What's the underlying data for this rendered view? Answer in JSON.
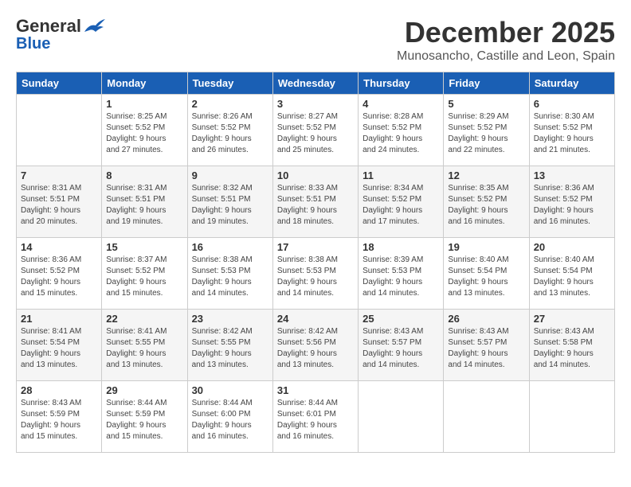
{
  "logo": {
    "general": "General",
    "blue": "Blue"
  },
  "header": {
    "month": "December 2025",
    "location": "Munosancho, Castille and Leon, Spain"
  },
  "weekdays": [
    "Sunday",
    "Monday",
    "Tuesday",
    "Wednesday",
    "Thursday",
    "Friday",
    "Saturday"
  ],
  "weeks": [
    [
      {
        "day": "",
        "info": ""
      },
      {
        "day": "1",
        "info": "Sunrise: 8:25 AM\nSunset: 5:52 PM\nDaylight: 9 hours\nand 27 minutes."
      },
      {
        "day": "2",
        "info": "Sunrise: 8:26 AM\nSunset: 5:52 PM\nDaylight: 9 hours\nand 26 minutes."
      },
      {
        "day": "3",
        "info": "Sunrise: 8:27 AM\nSunset: 5:52 PM\nDaylight: 9 hours\nand 25 minutes."
      },
      {
        "day": "4",
        "info": "Sunrise: 8:28 AM\nSunset: 5:52 PM\nDaylight: 9 hours\nand 24 minutes."
      },
      {
        "day": "5",
        "info": "Sunrise: 8:29 AM\nSunset: 5:52 PM\nDaylight: 9 hours\nand 22 minutes."
      },
      {
        "day": "6",
        "info": "Sunrise: 8:30 AM\nSunset: 5:52 PM\nDaylight: 9 hours\nand 21 minutes."
      }
    ],
    [
      {
        "day": "7",
        "info": "Sunrise: 8:31 AM\nSunset: 5:51 PM\nDaylight: 9 hours\nand 20 minutes."
      },
      {
        "day": "8",
        "info": "Sunrise: 8:31 AM\nSunset: 5:51 PM\nDaylight: 9 hours\nand 19 minutes."
      },
      {
        "day": "9",
        "info": "Sunrise: 8:32 AM\nSunset: 5:51 PM\nDaylight: 9 hours\nand 19 minutes."
      },
      {
        "day": "10",
        "info": "Sunrise: 8:33 AM\nSunset: 5:51 PM\nDaylight: 9 hours\nand 18 minutes."
      },
      {
        "day": "11",
        "info": "Sunrise: 8:34 AM\nSunset: 5:52 PM\nDaylight: 9 hours\nand 17 minutes."
      },
      {
        "day": "12",
        "info": "Sunrise: 8:35 AM\nSunset: 5:52 PM\nDaylight: 9 hours\nand 16 minutes."
      },
      {
        "day": "13",
        "info": "Sunrise: 8:36 AM\nSunset: 5:52 PM\nDaylight: 9 hours\nand 16 minutes."
      }
    ],
    [
      {
        "day": "14",
        "info": "Sunrise: 8:36 AM\nSunset: 5:52 PM\nDaylight: 9 hours\nand 15 minutes."
      },
      {
        "day": "15",
        "info": "Sunrise: 8:37 AM\nSunset: 5:52 PM\nDaylight: 9 hours\nand 15 minutes."
      },
      {
        "day": "16",
        "info": "Sunrise: 8:38 AM\nSunset: 5:53 PM\nDaylight: 9 hours\nand 14 minutes."
      },
      {
        "day": "17",
        "info": "Sunrise: 8:38 AM\nSunset: 5:53 PM\nDaylight: 9 hours\nand 14 minutes."
      },
      {
        "day": "18",
        "info": "Sunrise: 8:39 AM\nSunset: 5:53 PM\nDaylight: 9 hours\nand 14 minutes."
      },
      {
        "day": "19",
        "info": "Sunrise: 8:40 AM\nSunset: 5:54 PM\nDaylight: 9 hours\nand 13 minutes."
      },
      {
        "day": "20",
        "info": "Sunrise: 8:40 AM\nSunset: 5:54 PM\nDaylight: 9 hours\nand 13 minutes."
      }
    ],
    [
      {
        "day": "21",
        "info": "Sunrise: 8:41 AM\nSunset: 5:54 PM\nDaylight: 9 hours\nand 13 minutes."
      },
      {
        "day": "22",
        "info": "Sunrise: 8:41 AM\nSunset: 5:55 PM\nDaylight: 9 hours\nand 13 minutes."
      },
      {
        "day": "23",
        "info": "Sunrise: 8:42 AM\nSunset: 5:55 PM\nDaylight: 9 hours\nand 13 minutes."
      },
      {
        "day": "24",
        "info": "Sunrise: 8:42 AM\nSunset: 5:56 PM\nDaylight: 9 hours\nand 13 minutes."
      },
      {
        "day": "25",
        "info": "Sunrise: 8:43 AM\nSunset: 5:57 PM\nDaylight: 9 hours\nand 14 minutes."
      },
      {
        "day": "26",
        "info": "Sunrise: 8:43 AM\nSunset: 5:57 PM\nDaylight: 9 hours\nand 14 minutes."
      },
      {
        "day": "27",
        "info": "Sunrise: 8:43 AM\nSunset: 5:58 PM\nDaylight: 9 hours\nand 14 minutes."
      }
    ],
    [
      {
        "day": "28",
        "info": "Sunrise: 8:43 AM\nSunset: 5:59 PM\nDaylight: 9 hours\nand 15 minutes."
      },
      {
        "day": "29",
        "info": "Sunrise: 8:44 AM\nSunset: 5:59 PM\nDaylight: 9 hours\nand 15 minutes."
      },
      {
        "day": "30",
        "info": "Sunrise: 8:44 AM\nSunset: 6:00 PM\nDaylight: 9 hours\nand 16 minutes."
      },
      {
        "day": "31",
        "info": "Sunrise: 8:44 AM\nSunset: 6:01 PM\nDaylight: 9 hours\nand 16 minutes."
      },
      {
        "day": "",
        "info": ""
      },
      {
        "day": "",
        "info": ""
      },
      {
        "day": "",
        "info": ""
      }
    ]
  ]
}
